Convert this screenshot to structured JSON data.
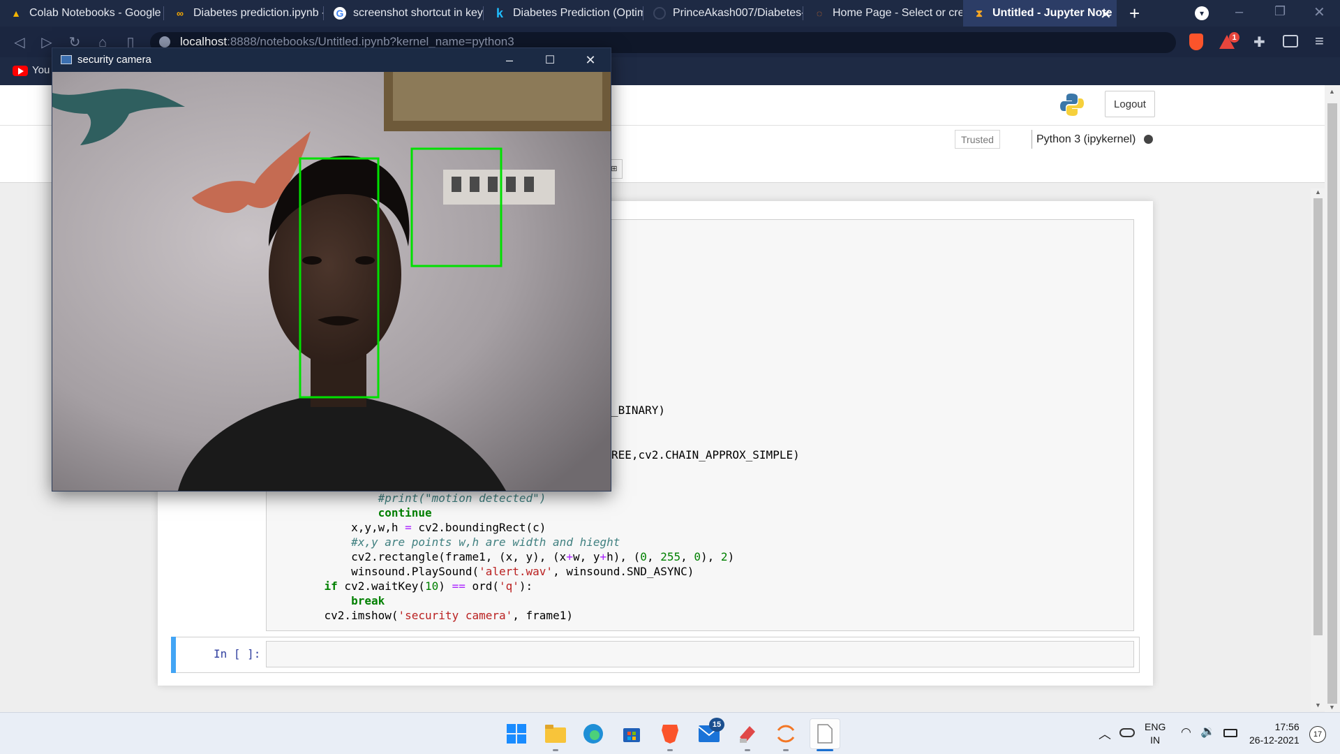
{
  "browser": {
    "tabs": [
      {
        "title": "Colab Notebooks - Google",
        "icon": "drive-icon"
      },
      {
        "title": "Diabetes prediction.ipynb -",
        "icon": "colab-icon"
      },
      {
        "title": "screenshot shortcut in keyb",
        "icon": "google-icon"
      },
      {
        "title": "Diabetes Prediction (Optim",
        "icon": "kaggle-icon"
      },
      {
        "title": "PrinceAkash007/Diabetes-p",
        "icon": "github-icon"
      },
      {
        "title": "Home Page - Select or crea",
        "icon": "jupyter-icon"
      },
      {
        "title": "Untitled - Jupyter Note",
        "icon": "hourglass-icon"
      }
    ],
    "url_host": "localhost",
    "url_path": ":8888/notebooks/Untitled.ipynb?kernel_name=python3",
    "bookmark_label": "You",
    "brave_badge": "1"
  },
  "jupyter": {
    "logout_label": "Logout",
    "trusted_label": "Trusted",
    "kernel_label": "Python 3 (ipykernel)",
    "prompt_empty": "In [ ]:"
  },
  "code_fragments": {
    "line_binary": "_BINARY)",
    "line_contours": "REE,cv2.CHAIN_APPROX_SIMPLE)"
  },
  "camera_window": {
    "title": "security camera",
    "detection_color": "#00e000"
  },
  "taskbar": {
    "mail_badge": "15",
    "lang_top": "ENG",
    "lang_bottom": "IN",
    "time": "17:56",
    "date": "26-12-2021",
    "notif_count": "17"
  }
}
